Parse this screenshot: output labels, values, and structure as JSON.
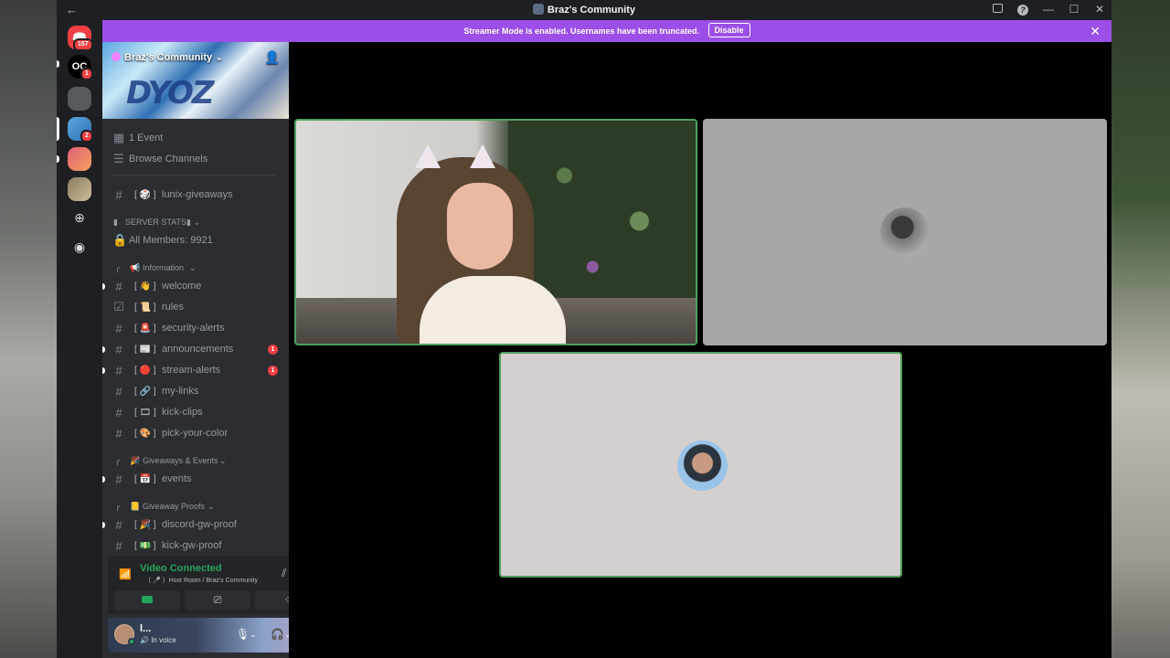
{
  "window": {
    "title": "Braz's Community",
    "back_icon": "←",
    "controls": [
      "—",
      "☐",
      "✕"
    ]
  },
  "rail": {
    "home_badge": "157",
    "server_badges": [
      "1",
      "2"
    ]
  },
  "banner": {
    "text": "Streamer Mode is enabled. Usernames have been truncated.",
    "button": "Disable",
    "close": "✕"
  },
  "server": {
    "name": "Braz's Community",
    "chevron": "⌄"
  },
  "top_items": [
    {
      "icon": "calendar-icon",
      "label": "1 Event"
    },
    {
      "icon": "browse-icon",
      "label": "Browse Channels"
    }
  ],
  "channels": {
    "giveaways": {
      "label": "lunix-giveaways",
      "emoji": "🎲"
    },
    "server_stats_category": "SERVER STATS",
    "members": "All Members: 9921",
    "information_category": "Information",
    "information": [
      {
        "label": "welcome",
        "emoji": "👋",
        "unread": true
      },
      {
        "label": "rules",
        "emoji": "📜",
        "unread": false
      },
      {
        "label": "security-alerts",
        "emoji": "🚨",
        "unread": false
      },
      {
        "label": "announcements",
        "emoji": "📰",
        "unread": true,
        "mentions": "1"
      },
      {
        "label": "stream-alerts",
        "emoji": "🔴",
        "unread": true,
        "mentions": "1"
      },
      {
        "label": "my-links",
        "emoji": "🔗",
        "unread": false
      },
      {
        "label": "kick-clips",
        "emoji": "🎞",
        "unread": false
      },
      {
        "label": "pick-your-color",
        "emoji": "🎨",
        "unread": false
      }
    ],
    "events_category": "Giveaways & Events",
    "events": {
      "label": "events",
      "emoji": "📅",
      "unread": true
    },
    "proofs_category": "Giveaway Proofs",
    "proofs": [
      {
        "label": "discord-gw-proof",
        "emoji": "🎉",
        "unread": true
      },
      {
        "label": "kick-gw-proof",
        "emoji": "💵",
        "unread": false
      }
    ]
  },
  "voice": {
    "status": "Video Connected",
    "room": "〔 🎤 〕Host Room / Braz's Community"
  },
  "user": {
    "name": "l...",
    "sub": "In voice"
  },
  "colors": {
    "accent": "#9b4fe8",
    "speaking": "#4fa05c",
    "mention": "#f23f43",
    "connected": "#23a55a"
  }
}
